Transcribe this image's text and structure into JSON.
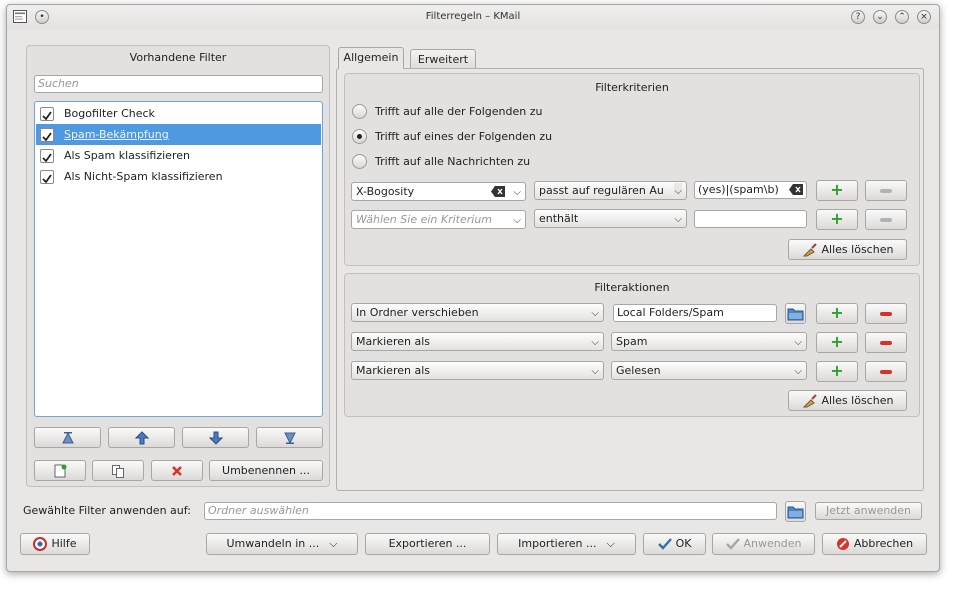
{
  "window": {
    "title": "Filterregeln – KMail"
  },
  "left": {
    "title": "Vorhandene Filter",
    "search_placeholder": "Suchen",
    "filters": [
      {
        "label": "Bogofilter Check",
        "checked": true,
        "selected": false
      },
      {
        "label": "Spam-Bekämpfung",
        "checked": true,
        "selected": true
      },
      {
        "label": "Als Spam klassifizieren",
        "checked": true,
        "selected": false
      },
      {
        "label": "Als Nicht-Spam klassifizieren",
        "checked": true,
        "selected": false
      }
    ],
    "rename_label": "Umbenennen ..."
  },
  "tabs": [
    {
      "label": "Allgemein",
      "active": true
    },
    {
      "label": "Erweitert",
      "active": false
    }
  ],
  "criteria": {
    "title": "Filterkriterien",
    "options": [
      {
        "label": "Trifft auf alle der Folgenden zu",
        "selected": false
      },
      {
        "label": "Trifft auf eines der Folgenden zu",
        "selected": true
      },
      {
        "label": "Trifft auf alle Nachrichten zu",
        "selected": false
      }
    ],
    "rows": [
      {
        "field": "X-Bogosity",
        "field_placeholder": "",
        "operator": "passt auf regulären Au",
        "value": "(yes)|(spam\\b)"
      },
      {
        "field": "",
        "field_placeholder": "Wählen Sie ein Kriterium",
        "operator": "enthält",
        "value": ""
      }
    ],
    "clear_label": "Alles löschen"
  },
  "actions": {
    "title": "Filteraktionen",
    "rows": [
      {
        "action": "In Ordner verschieben",
        "value": "Local Folders/Spam"
      },
      {
        "action": "Markieren als",
        "value": "Spam"
      },
      {
        "action": "Markieren als",
        "value": "Gelesen"
      }
    ],
    "clear_label": "Alles löschen"
  },
  "apply": {
    "label": "Gewählte Filter anwenden auf:",
    "folder_placeholder": "Ordner auswählen",
    "apply_now_label": "Jetzt anwenden"
  },
  "footer": {
    "help": "Hilfe",
    "convert": "Umwandeln in ...",
    "export": "Exportieren ...",
    "import": "Importieren ...",
    "ok": "OK",
    "apply": "Anwenden",
    "cancel": "Abbrechen"
  },
  "colors": {
    "accent": "#4f99e0",
    "add_green": "#2ca02c",
    "remove_red": "#d8322a"
  }
}
